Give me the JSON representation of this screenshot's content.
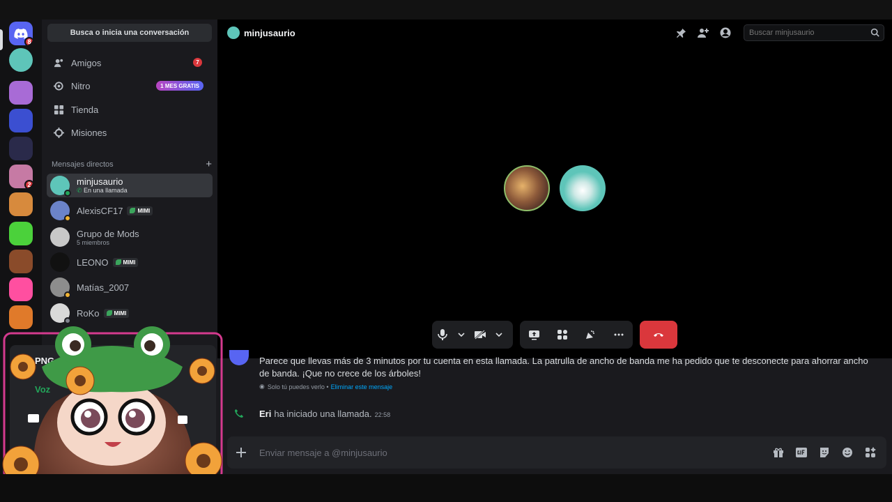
{
  "rail": {
    "home_badge": "8",
    "servers": [
      {
        "name": "dm-active-call",
        "color": "#5ec5b9"
      },
      {
        "name": "server-1",
        "color": "#a86bd6"
      },
      {
        "name": "server-2",
        "color": "#3b4fd1"
      },
      {
        "name": "server-3",
        "color": "#2a2a4a"
      },
      {
        "name": "server-4",
        "color": "#c67aa4",
        "badge": "2"
      },
      {
        "name": "server-5",
        "color": "#d78a3d"
      },
      {
        "name": "server-6",
        "color": "#4bd13b"
      },
      {
        "name": "server-7",
        "color": "#8a4b2a"
      },
      {
        "name": "server-8",
        "color": "#ff4fa0"
      },
      {
        "name": "server-9",
        "color": "#e07a2a"
      }
    ]
  },
  "sidebar": {
    "search_label": "Busca o inicia una conversación",
    "nav": [
      {
        "label": "Amigos",
        "badge": "7",
        "icon": "friends-icon"
      },
      {
        "label": "Nitro",
        "badge_text": "1 MES GRATIS",
        "icon": "nitro-icon"
      },
      {
        "label": "Tienda",
        "icon": "shop-icon"
      },
      {
        "label": "Misiones",
        "icon": "quests-icon"
      }
    ],
    "dm_header": "Mensajes directos",
    "dms": [
      {
        "name": "minjusaurio",
        "sub": "En una llamada",
        "color": "#5ec5b9",
        "active": true
      },
      {
        "name": "AlexisCF17",
        "tag": "MIMI",
        "color": "#6b83c9",
        "status": "#f0b232"
      },
      {
        "name": "Grupo de Mods",
        "sub": "5 miembros",
        "color": "#c8c8c8"
      },
      {
        "name": "LEONO",
        "tag": "MIMI",
        "color": "#111111"
      },
      {
        "name": "Matías_2007",
        "color": "#8d8d8d",
        "status": "#f0b232"
      },
      {
        "name": "RoKo",
        "tag": "MIMI",
        "color": "#d9d9d9",
        "status": "#80848e"
      }
    ]
  },
  "userpanel": {
    "png_label": "PNG",
    "voice_label": "Voz"
  },
  "main": {
    "title": "minjusaurio",
    "search_placeholder": "Buscar minjusaurio",
    "system_message": "Parece que llevas más de 3 minutos por tu cuenta en esta llamada. La patrulla de ancho de banda me ha pedido que te desconecte para ahorrar ancho de banda. ¡Que no crece de los árboles!",
    "only_you": "Solo tú puedes verlo •",
    "delete_link": "Eliminar este mensaje",
    "call_user": "Eri",
    "call_text": "ha iniciado una llamada.",
    "call_time": "22:58",
    "composer_placeholder": "Enviar mensaje a @minjusaurio"
  },
  "colors": {
    "blurple": "#5865f2",
    "danger": "#da373c",
    "online": "#23a55a",
    "participant_1": "#8fbf6a",
    "participant_2": "#5ec5b9"
  }
}
